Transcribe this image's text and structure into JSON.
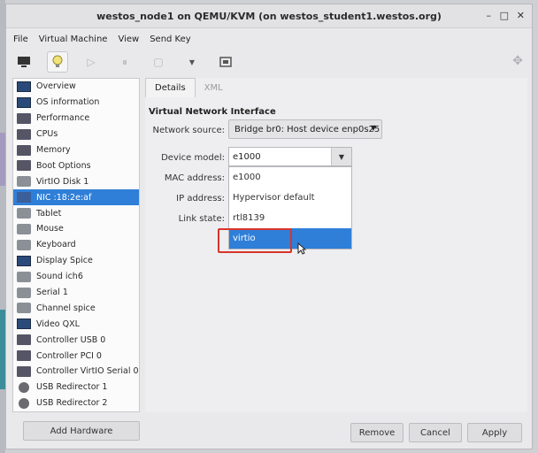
{
  "window": {
    "title": "westos_node1 on QEMU/KVM (on westos_student1.westos.org)"
  },
  "menu": [
    "File",
    "Virtual Machine",
    "View",
    "Send Key"
  ],
  "sidebar": {
    "items": [
      {
        "label": "Overview",
        "icon": "monitor-icon"
      },
      {
        "label": "OS information",
        "icon": "info-icon"
      },
      {
        "label": "Performance",
        "icon": "performance-icon"
      },
      {
        "label": "CPUs",
        "icon": "cpu-icon"
      },
      {
        "label": "Memory",
        "icon": "memory-icon"
      },
      {
        "label": "Boot Options",
        "icon": "boot-icon"
      },
      {
        "label": "VirtIO Disk 1",
        "icon": "disk-icon"
      },
      {
        "label": "NIC :18:2e:af",
        "icon": "nic-icon",
        "selected": true
      },
      {
        "label": "Tablet",
        "icon": "tablet-icon"
      },
      {
        "label": "Mouse",
        "icon": "mouse-icon"
      },
      {
        "label": "Keyboard",
        "icon": "keyboard-icon"
      },
      {
        "label": "Display Spice",
        "icon": "display-icon"
      },
      {
        "label": "Sound ich6",
        "icon": "sound-icon"
      },
      {
        "label": "Serial 1",
        "icon": "serial-icon"
      },
      {
        "label": "Channel spice",
        "icon": "channel-icon"
      },
      {
        "label": "Video QXL",
        "icon": "video-icon"
      },
      {
        "label": "Controller USB 0",
        "icon": "controller-icon"
      },
      {
        "label": "Controller PCI 0",
        "icon": "controller-icon"
      },
      {
        "label": "Controller VirtIO Serial 0",
        "icon": "controller-icon"
      },
      {
        "label": "USB Redirector 1",
        "icon": "usb-icon"
      },
      {
        "label": "USB Redirector 2",
        "icon": "usb-icon"
      }
    ]
  },
  "add_hardware": "Add Hardware",
  "tabs": [
    "Details",
    "XML"
  ],
  "details": {
    "section_title": "Virtual Network Interface",
    "network_source_label": "Network source:",
    "network_source_value": "Bridge br0: Host device enp0s25",
    "device_model_label": "Device model:",
    "device_model_value": "e1000",
    "mac_label": "MAC address:",
    "ip_label": "IP address:",
    "link_label": "Link state:",
    "dropdown_options": [
      "e1000",
      "Hypervisor default",
      "rtl8139",
      "virtio"
    ],
    "dropdown_selected": "virtio"
  },
  "buttons": {
    "remove": "Remove",
    "cancel": "Cancel",
    "apply": "Apply"
  },
  "colors": {
    "accent": "#2f7fd8",
    "highlight": "#d8342b"
  }
}
